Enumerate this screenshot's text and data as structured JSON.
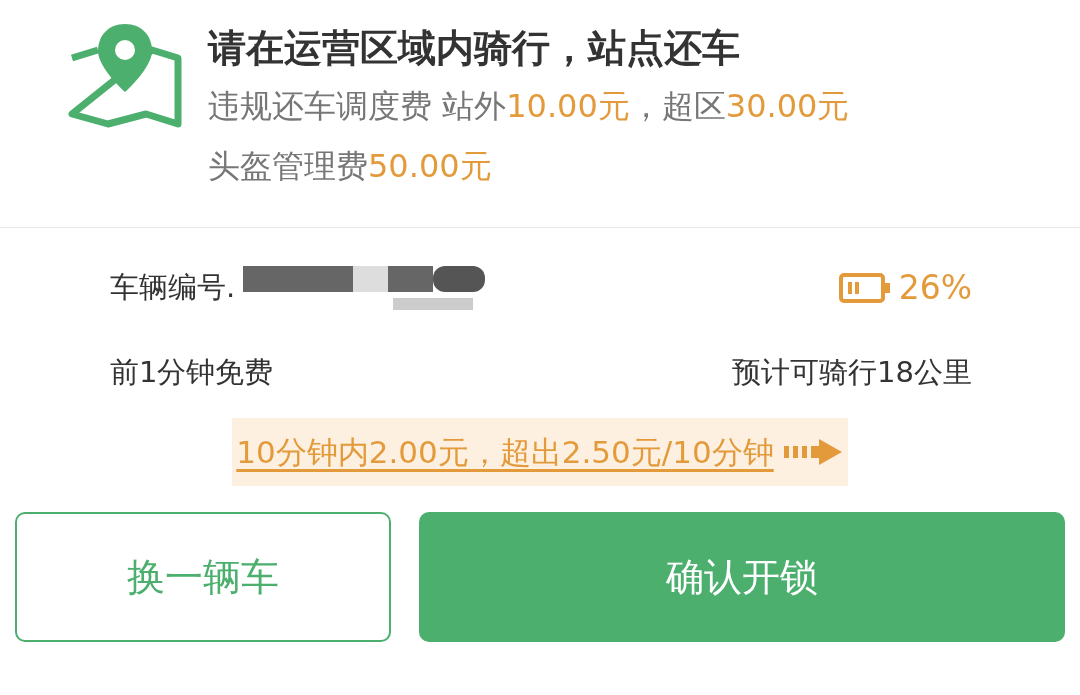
{
  "notice": {
    "title": "请在运营区域内骑行，站点还车",
    "lines": [
      [
        {
          "text": "违规还车调度费 站外",
          "kind": "plain"
        },
        {
          "text": "10.00元",
          "kind": "highlight"
        },
        {
          "text": "，超区",
          "kind": "plain"
        },
        {
          "text": "30.00元",
          "kind": "highlight"
        }
      ],
      [
        {
          "text": "头盔管理费",
          "kind": "plain"
        },
        {
          "text": "50.00元",
          "kind": "highlight"
        }
      ]
    ]
  },
  "vehicle": {
    "number_label": "车辆编号.",
    "battery": "26%",
    "free_time": "前1分钟免费",
    "range": "预计可骑行18公里"
  },
  "pricing_link": "10分钟内2.00元，超出2.50元/10分钟",
  "buttons": [
    {
      "label": "换一辆车",
      "kind": "secondary"
    },
    {
      "label": "确认开锁",
      "kind": "primary"
    }
  ]
}
